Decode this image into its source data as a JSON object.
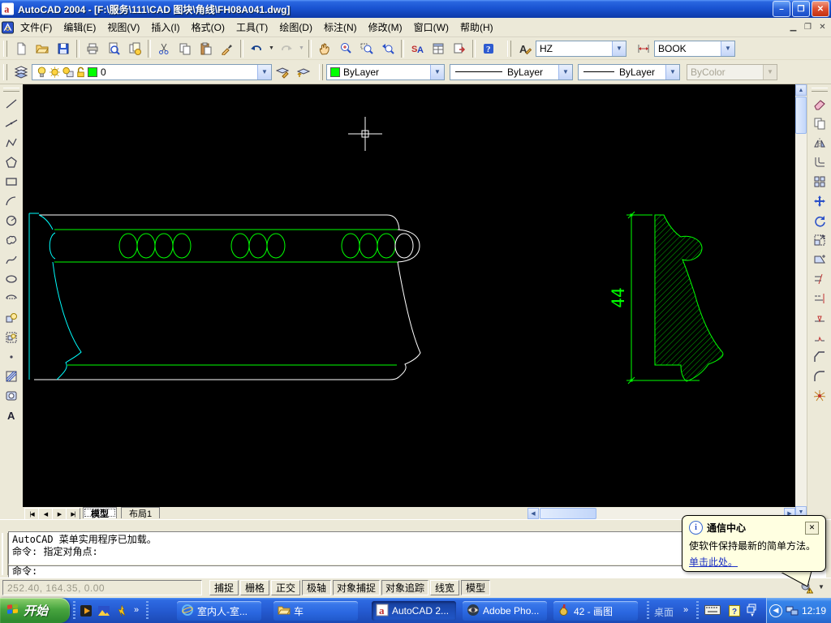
{
  "window": {
    "title": "AutoCAD 2004 - [F:\\服务\\111\\CAD 图块\\角线\\FH08A041.dwg]",
    "minimize": "–",
    "restore": "❐",
    "close": "✕"
  },
  "menu_bar": {
    "items": [
      {
        "label": "文件(F)"
      },
      {
        "label": "编辑(E)"
      },
      {
        "label": "视图(V)"
      },
      {
        "label": "插入(I)"
      },
      {
        "label": "格式(O)"
      },
      {
        "label": "工具(T)"
      },
      {
        "label": "绘图(D)"
      },
      {
        "label": "标注(N)"
      },
      {
        "label": "修改(M)"
      },
      {
        "label": "窗口(W)"
      },
      {
        "label": "帮助(H)"
      }
    ]
  },
  "standard_toolbar": {
    "icons": [
      "new",
      "open",
      "save",
      "print",
      "print-preview",
      "publish",
      "cut",
      "copy",
      "paste",
      "match-properties",
      "undo",
      "redo",
      "pan-realtime",
      "zoom-realtime",
      "zoom-window",
      "zoom-previous",
      "find",
      "properties",
      "design-center",
      "help"
    ]
  },
  "style_toolbar": {
    "text_style": "HZ",
    "dim_style": "BOOK"
  },
  "layers_toolbar": {
    "layer_name": "0",
    "layer_color": "#00ff00",
    "state_icons": [
      "bulb",
      "sun",
      "viewport-freeze",
      "lock"
    ]
  },
  "properties_toolbar": {
    "color": "ByLayer",
    "linetype": "ByLayer",
    "lineweight": "ByLayer",
    "plot_style": "ByColor"
  },
  "draw_toolbar": {
    "icons": [
      "line",
      "construction-line",
      "polyline",
      "polygon",
      "rectangle",
      "arc",
      "circle",
      "revision-cloud",
      "spline",
      "ellipse",
      "ellipse-arc",
      "insert-block",
      "make-block",
      "point",
      "hatch",
      "region",
      "multiline-text"
    ]
  },
  "modify_toolbar": {
    "icons": [
      "erase",
      "copy-object",
      "mirror",
      "offset",
      "array",
      "move",
      "rotate",
      "scale",
      "stretch",
      "trim",
      "extend",
      "break-at-point",
      "break",
      "chamfer",
      "fillet",
      "explode"
    ]
  },
  "canvas": {
    "background": "#000000",
    "line_colors": {
      "cyan": "#00ffff",
      "green": "#00ff00",
      "white": "#ffffff"
    },
    "dimension_label": "44"
  },
  "layout_tabs": {
    "tabs": [
      {
        "label": "模型",
        "active": true
      },
      {
        "label": "布局1",
        "active": false
      }
    ]
  },
  "command_line": {
    "history": [
      "AutoCAD 菜单实用程序已加载。",
      "命令: 指定对角点:"
    ],
    "prompt": "命令:"
  },
  "status_bar": {
    "coordinates": "252.40, 164.35, 0.00",
    "toggles": [
      {
        "label": "捕捉",
        "pressed": false
      },
      {
        "label": "栅格",
        "pressed": false
      },
      {
        "label": "正交",
        "pressed": false
      },
      {
        "label": "极轴",
        "pressed": true
      },
      {
        "label": "对象捕捉",
        "pressed": true
      },
      {
        "label": "对象追踪",
        "pressed": true
      },
      {
        "label": "线宽",
        "pressed": false
      },
      {
        "label": "模型",
        "pressed": true
      }
    ]
  },
  "balloon": {
    "title": "通信中心",
    "body": "使软件保持最新的简单方法。",
    "link": "单击此处。"
  },
  "taskbar": {
    "start": "开始",
    "quick_launch": [
      "media-player",
      "image-viewer",
      "winamp"
    ],
    "overflow": "»",
    "tasks": [
      {
        "label": "室内人-室...",
        "icon": "ie",
        "active": false
      },
      {
        "label": "车",
        "icon": "folder",
        "active": false
      },
      {
        "label": "AutoCAD 2...",
        "icon": "autocad",
        "active": true
      },
      {
        "label": "Adobe Pho...",
        "icon": "photoshop",
        "active": false
      },
      {
        "label": "42 - 画图",
        "icon": "paint",
        "active": false
      }
    ],
    "desktop": "桌面",
    "desktop_chevron": "»",
    "tray_icons": [
      "keyboard",
      "ime-help",
      "restore-window",
      "hide-icons",
      "network"
    ],
    "clock": "12:19"
  }
}
